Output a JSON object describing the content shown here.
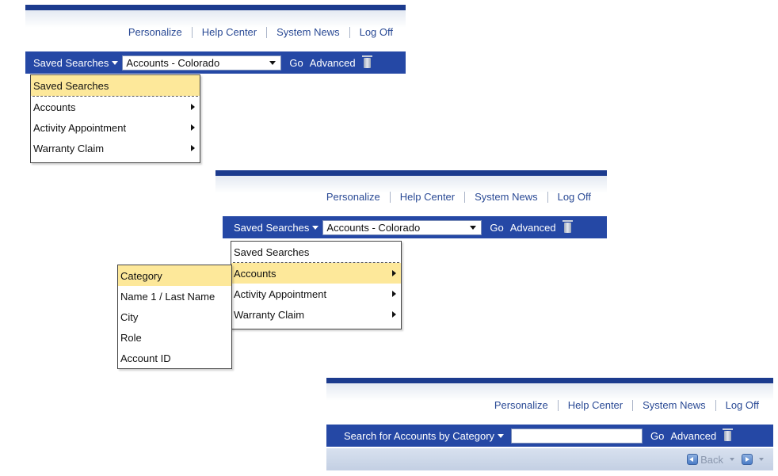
{
  "header_links": [
    "Personalize",
    "Help Center",
    "System News",
    "Log Off"
  ],
  "panel1": {
    "saved_searches_label": "Saved Searches",
    "search_value": "Accounts - Colorado",
    "go_label": "Go",
    "advanced_label": "Advanced",
    "menu": {
      "header": "Saved Searches",
      "items": [
        "Accounts",
        "Activity Appointment",
        "Warranty Claim"
      ]
    }
  },
  "panel2": {
    "saved_searches_label": "Saved Searches",
    "search_value": "Accounts - Colorado",
    "go_label": "Go",
    "advanced_label": "Advanced",
    "menu": {
      "header": "Saved Searches",
      "items": [
        "Accounts",
        "Activity Appointment",
        "Warranty Claim"
      ],
      "highlighted": "Accounts"
    },
    "submenu": {
      "items": [
        "Category",
        "Name 1 / Last Name",
        "City",
        "Role",
        "Account ID"
      ],
      "highlighted": "Category"
    }
  },
  "panel3": {
    "search_label": "Search for Accounts by Category",
    "search_value": "",
    "go_label": "Go",
    "advanced_label": "Advanced",
    "back_label": "Back"
  }
}
